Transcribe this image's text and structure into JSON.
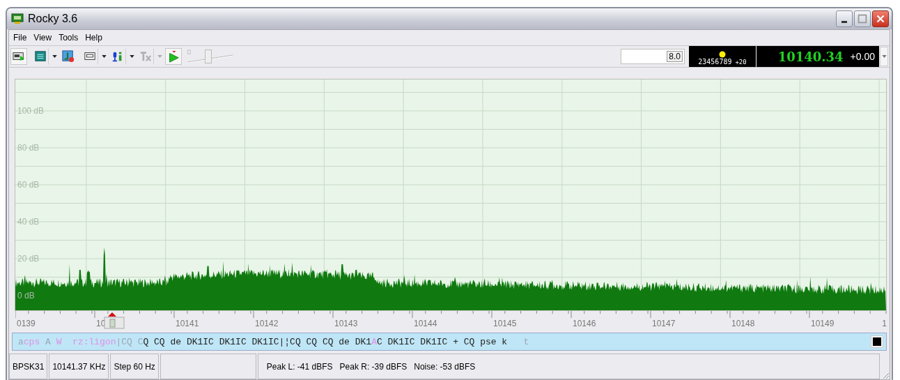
{
  "window": {
    "title": "Rocky 3.6"
  },
  "menu": [
    "File",
    "View",
    "Tools",
    "Help"
  ],
  "toolbar": {
    "buttons": [
      {
        "kind": "card",
        "pressed": true,
        "dropdown": false
      },
      {
        "kind": "screen",
        "pressed": false,
        "dropdown": true
      },
      {
        "kind": "chart",
        "pressed": false,
        "dropdown": false
      },
      {
        "kind": "cassette",
        "pressed": false,
        "dropdown": true
      },
      {
        "kind": "mic",
        "pressed": false,
        "dropdown": true
      },
      {
        "kind": "tx",
        "pressed": false,
        "dropdown": true,
        "disabled": true
      },
      {
        "kind": "play",
        "pressed": true,
        "dropdown": false
      }
    ],
    "slider": {
      "level": 0.45
    },
    "level_field": {
      "value": "8.0"
    },
    "digits_display": {
      "digits": "23456789",
      "offset": "+20"
    },
    "frequency_display": {
      "frequency": "10140.34",
      "offset": "+0.00"
    }
  },
  "spectrum": {
    "db_labels": [
      "100 dB",
      "80 dB",
      "60 dB",
      "40 dB",
      "20 dB",
      "0 dB"
    ],
    "freq_labels": [
      "0139",
      "10",
      "10141",
      "10142",
      "10143",
      "10144",
      "10145",
      "10146",
      "10147",
      "10148",
      "10149",
      "1"
    ]
  },
  "receive_text": [
    {
      "text": "a",
      "kind": "faint"
    },
    {
      "text": "cps",
      "kind": "pink"
    },
    {
      "text": " A ",
      "kind": "faint"
    },
    {
      "text": "W",
      "kind": "pink"
    },
    {
      "text": "  rz:ligon",
      "kind": "pink"
    },
    {
      "text": "|CQ C",
      "kind": "faint"
    },
    {
      "text": "Q CQ de DK1IC DK1IC DK1IC|¦CQ CQ CQ de DK1",
      "kind": "normal"
    },
    {
      "text": "A",
      "kind": "pink"
    },
    {
      "text": "C DK1IC DK1IC + CQ pse k",
      "kind": "normal"
    },
    {
      "text": "   t",
      "kind": "faint"
    }
  ],
  "status_bar": {
    "mode": "BPSK31",
    "frequency": "10141.37 KHz",
    "step": "Step 60 Hz",
    "readings": [
      "Peak L: -41 dBFS",
      "Peak R: -39 dBFS",
      "Noise: -53 dBFS"
    ]
  }
}
